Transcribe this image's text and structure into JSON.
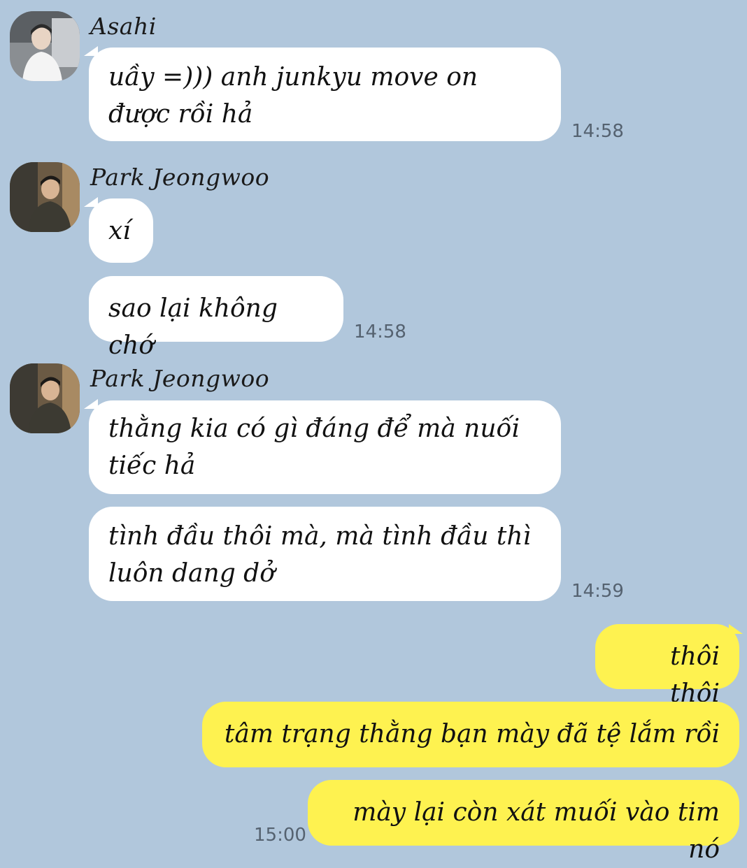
{
  "messages": [
    {
      "sender": "Asahi",
      "text": "uầy =))) anh junkyu move on được rồi hả",
      "time": "14:58"
    },
    {
      "sender": "Park Jeongwoo",
      "texts": [
        "xí",
        "sao lại không chớ"
      ],
      "time": "14:58"
    },
    {
      "sender": "Park Jeongwoo",
      "texts": [
        "thằng kia có gì đáng để mà nuối tiếc hả",
        "tình đầu thôi mà, mà tình đầu thì luôn dang dở"
      ],
      "time": "14:59"
    }
  ],
  "outgoing": {
    "texts": [
      "thôi thôi",
      "tâm trạng thằng bạn mày đã tệ lắm rồi",
      "mày lại còn xát muối vào tim nó"
    ],
    "time": "15:00"
  },
  "colors": {
    "background": "#b1c7dc",
    "incoming_bubble": "#ffffff",
    "outgoing_bubble": "#fef250"
  }
}
